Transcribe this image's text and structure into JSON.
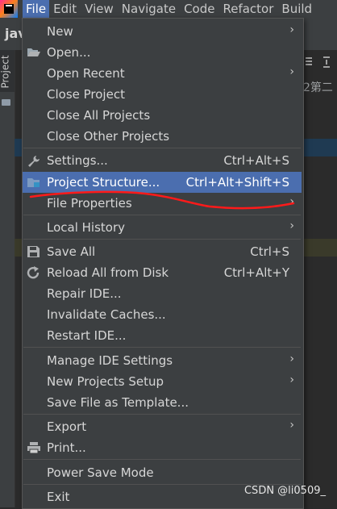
{
  "menubar": {
    "items": [
      "File",
      "Edit",
      "View",
      "Navigate",
      "Code",
      "Refactor",
      "Build"
    ]
  },
  "background": {
    "tab_label": "jav",
    "project_tool_label": "Project",
    "right_text": "2第二"
  },
  "file_menu": {
    "items": [
      {
        "label": "New",
        "shortcut": "",
        "submenu": true,
        "icon": ""
      },
      {
        "label": "Open...",
        "shortcut": "",
        "submenu": false,
        "icon": "folder-open-icon"
      },
      {
        "label": "Open Recent",
        "shortcut": "",
        "submenu": true,
        "icon": ""
      },
      {
        "label": "Close Project",
        "shortcut": "",
        "submenu": false,
        "icon": ""
      },
      {
        "label": "Close All Projects",
        "shortcut": "",
        "submenu": false,
        "icon": ""
      },
      {
        "label": "Close Other Projects",
        "shortcut": "",
        "submenu": false,
        "icon": ""
      },
      {
        "label": "Settings...",
        "shortcut": "Ctrl+Alt+S",
        "submenu": false,
        "icon": "wrench-icon"
      },
      {
        "label": "Project Structure...",
        "shortcut": "Ctrl+Alt+Shift+S",
        "submenu": false,
        "icon": "project-structure-icon",
        "selected": true
      },
      {
        "label": "File Properties",
        "shortcut": "",
        "submenu": true,
        "icon": ""
      },
      {
        "label": "Local History",
        "shortcut": "",
        "submenu": true,
        "icon": ""
      },
      {
        "label": "Save All",
        "shortcut": "Ctrl+S",
        "submenu": false,
        "icon": "save-icon"
      },
      {
        "label": "Reload All from Disk",
        "shortcut": "Ctrl+Alt+Y",
        "submenu": false,
        "icon": "reload-icon"
      },
      {
        "label": "Repair IDE...",
        "shortcut": "",
        "submenu": false,
        "icon": ""
      },
      {
        "label": "Invalidate Caches...",
        "shortcut": "",
        "submenu": false,
        "icon": ""
      },
      {
        "label": "Restart IDE...",
        "shortcut": "",
        "submenu": false,
        "icon": ""
      },
      {
        "label": "Manage IDE Settings",
        "shortcut": "",
        "submenu": true,
        "icon": ""
      },
      {
        "label": "New Projects Setup",
        "shortcut": "",
        "submenu": true,
        "icon": ""
      },
      {
        "label": "Save File as Template...",
        "shortcut": "",
        "submenu": false,
        "icon": ""
      },
      {
        "label": "Export",
        "shortcut": "",
        "submenu": true,
        "icon": ""
      },
      {
        "label": "Print...",
        "shortcut": "",
        "submenu": false,
        "icon": "print-icon"
      },
      {
        "label": "Power Save Mode",
        "shortcut": "",
        "submenu": false,
        "icon": ""
      },
      {
        "label": "Exit",
        "shortcut": "",
        "submenu": false,
        "icon": ""
      }
    ]
  },
  "submenu_arrow": "›",
  "watermark": "CSDN @li0509_",
  "colors": {
    "menu_bg": "#3c3f41",
    "selection": "#4b6eaf",
    "annotation": "#ff0000"
  }
}
